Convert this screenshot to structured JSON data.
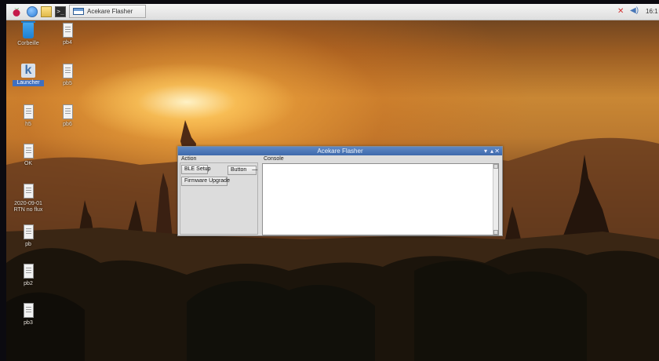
{
  "taskbar": {
    "terminal_glyph": ">_",
    "task_button": "Acekare Flasher",
    "clock": "16:1"
  },
  "desktop": {
    "icons": [
      {
        "label": "Corbeille",
        "type": "trash"
      },
      {
        "label": "pb4",
        "type": "file"
      },
      {
        "label": "Launcher",
        "type": "launcher",
        "glyph": "k"
      },
      {
        "label": "pb5",
        "type": "file"
      },
      {
        "label": "h5",
        "type": "file"
      },
      {
        "label": "pb6",
        "type": "file"
      },
      {
        "label": "OK",
        "type": "file"
      },
      {
        "label": "2020-09-01",
        "label2": "RTN no flux",
        "type": "file"
      },
      {
        "label": "pb",
        "type": "file"
      },
      {
        "label": "pb2",
        "type": "file"
      },
      {
        "label": "pb3",
        "type": "file"
      }
    ]
  },
  "window": {
    "title": "Acekare Flasher",
    "controls": {
      "minimize": "▾",
      "maximize": "▴",
      "close": "✕"
    },
    "action_label": "Action",
    "console_label": "Console",
    "buttons": {
      "ble_setup": "BLE Setup",
      "button_select": "Button",
      "button_arrow": "—",
      "firmware_upgrade": "Firmware Upgrade"
    }
  }
}
